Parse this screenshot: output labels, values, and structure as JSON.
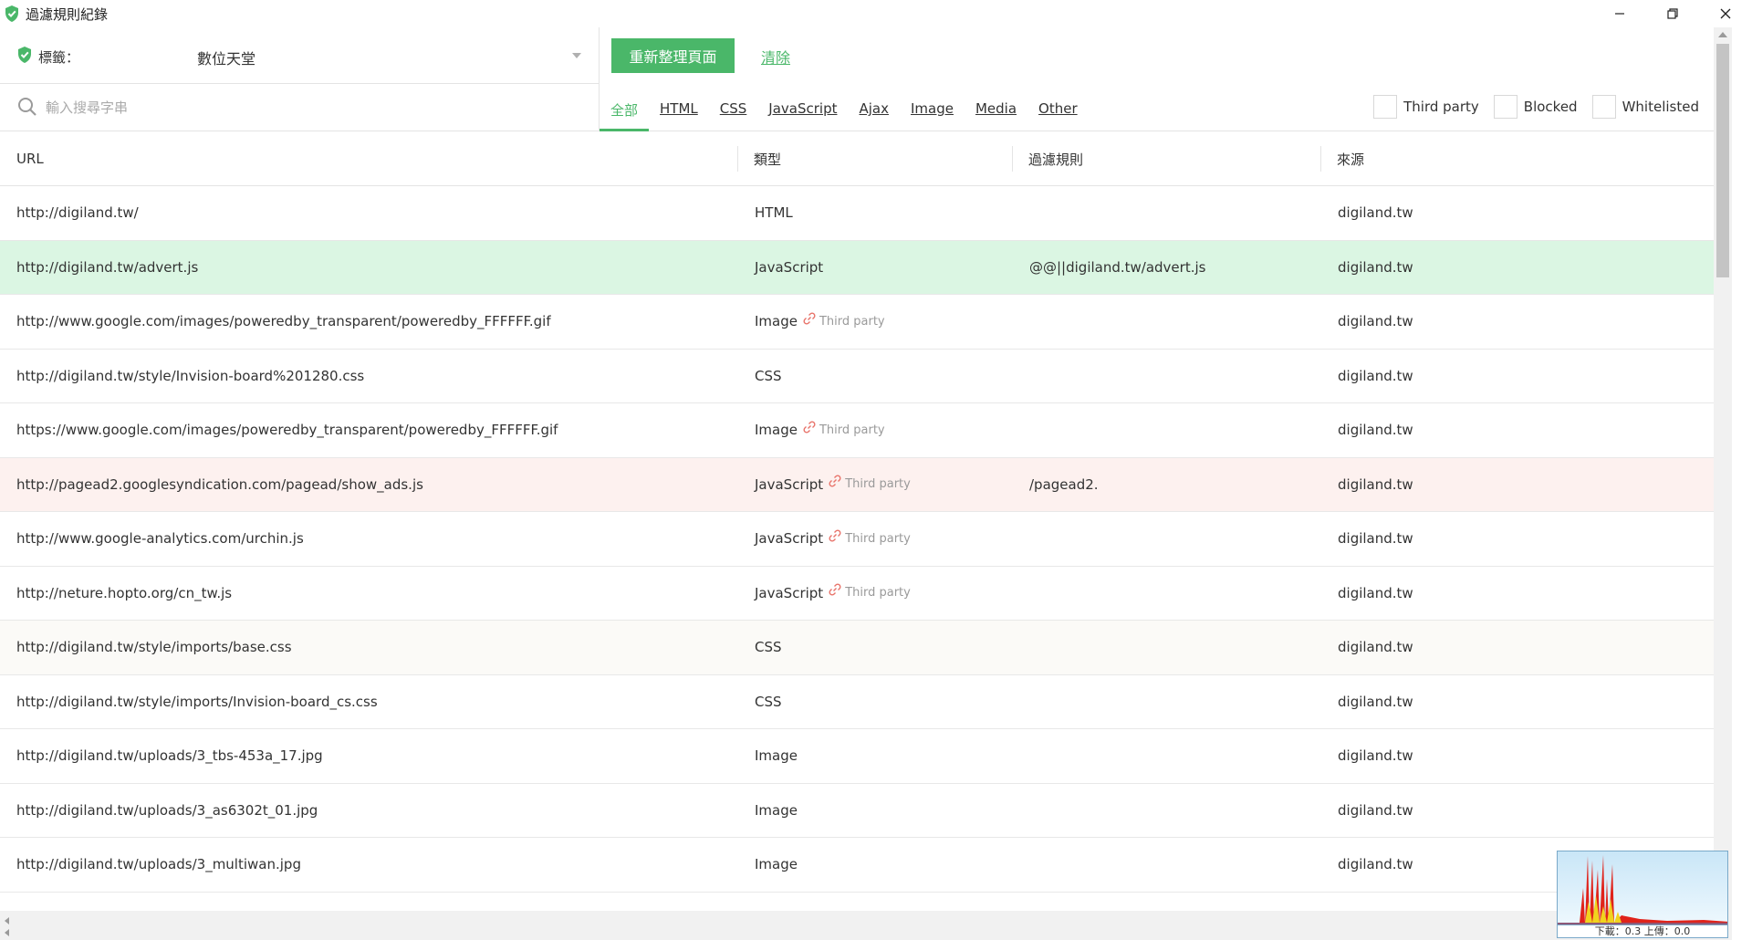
{
  "window": {
    "title": "過濾規則紀錄",
    "minimize_glyph": "—",
    "maximize_glyph": "❐",
    "close_glyph": "✕"
  },
  "header": {
    "tag_label": "標籤：",
    "tag_value": "數位天堂",
    "refresh_label": "重新整理頁面",
    "clear_label": "清除"
  },
  "search": {
    "placeholder": "輸入搜尋字串",
    "value": ""
  },
  "tabs": [
    {
      "label": "全部",
      "active": true
    },
    {
      "label": "HTML"
    },
    {
      "label": "CSS"
    },
    {
      "label": "JavaScript"
    },
    {
      "label": "Ajax"
    },
    {
      "label": "Image"
    },
    {
      "label": "Media"
    },
    {
      "label": "Other"
    }
  ],
  "checkboxes": [
    {
      "label": "Third party",
      "checked": false
    },
    {
      "label": "Blocked",
      "checked": false
    },
    {
      "label": "Whitelisted",
      "checked": false
    }
  ],
  "table": {
    "columns": [
      "URL",
      "類型",
      "過濾規則",
      "來源"
    ],
    "third_party_label": "Third party",
    "rows": [
      {
        "url": "http://digiland.tw/",
        "type": "HTML",
        "third_party": false,
        "rule": "",
        "source": "digiland.tw",
        "state": "normal"
      },
      {
        "url": "http://digiland.tw/advert.js",
        "type": "JavaScript",
        "third_party": false,
        "rule": "@@||digiland.tw/advert.js",
        "source": "digiland.tw",
        "state": "allowed"
      },
      {
        "url": "http://www.google.com/images/poweredby_transparent/poweredby_FFFFFF.gif",
        "type": "Image",
        "third_party": true,
        "rule": "",
        "source": "digiland.tw",
        "state": "normal"
      },
      {
        "url": "http://digiland.tw/style/Invision-board%201280.css",
        "type": "CSS",
        "third_party": false,
        "rule": "",
        "source": "digiland.tw",
        "state": "normal"
      },
      {
        "url": "https://www.google.com/images/poweredby_transparent/poweredby_FFFFFF.gif",
        "type": "Image",
        "third_party": true,
        "rule": "",
        "source": "digiland.tw",
        "state": "normal"
      },
      {
        "url": "http://pagead2.googlesyndication.com/pagead/show_ads.js",
        "type": "JavaScript",
        "third_party": true,
        "rule": "/pagead2.",
        "source": "digiland.tw",
        "state": "blocked"
      },
      {
        "url": "http://www.google-analytics.com/urchin.js",
        "type": "JavaScript",
        "third_party": true,
        "rule": "",
        "source": "digiland.tw",
        "state": "normal"
      },
      {
        "url": "http://neture.hopto.org/cn_tw.js",
        "type": "JavaScript",
        "third_party": true,
        "rule": "",
        "source": "digiland.tw",
        "state": "normal"
      },
      {
        "url": "http://digiland.tw/style/imports/base.css",
        "type": "CSS",
        "third_party": false,
        "rule": "",
        "source": "digiland.tw",
        "state": "alt"
      },
      {
        "url": "http://digiland.tw/style/imports/Invision-board_cs.css",
        "type": "CSS",
        "third_party": false,
        "rule": "",
        "source": "digiland.tw",
        "state": "normal"
      },
      {
        "url": "http://digiland.tw/uploads/3_tbs-453a_17.jpg",
        "type": "Image",
        "third_party": false,
        "rule": "",
        "source": "digiland.tw",
        "state": "normal"
      },
      {
        "url": "http://digiland.tw/uploads/3_as6302t_01.jpg",
        "type": "Image",
        "third_party": false,
        "rule": "",
        "source": "digiland.tw",
        "state": "normal"
      },
      {
        "url": "http://digiland.tw/uploads/3_multiwan.jpg",
        "type": "Image",
        "third_party": false,
        "rule": "",
        "source": "digiland.tw",
        "state": "normal"
      }
    ]
  },
  "traffic_widget": {
    "readout": "下載：0.3 上傳：0.0"
  },
  "colors": {
    "accent": "#4ab769",
    "allowed_row": "#dbf6e3",
    "blocked_row": "#fdf1ef",
    "link_icon": "#e8736a"
  },
  "icons": {
    "app": "shield-check-icon",
    "search": "search-icon",
    "third_party": "link-icon"
  }
}
